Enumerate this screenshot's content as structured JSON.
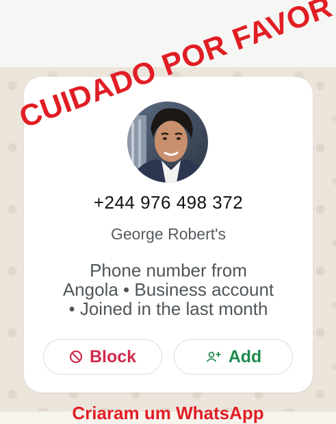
{
  "overlay": {
    "warning_text": "CUIDADO POR FAVOR",
    "bottom_caption": "Criaram um WhatsApp"
  },
  "contact_card": {
    "phone_number": "+244 976 498 372",
    "profile_name": "George Robert's",
    "info_lines": [
      "Phone number from",
      "Angola • Business account",
      "• Joined in the last month"
    ]
  },
  "actions": {
    "block_label": "Block",
    "add_label": "Add"
  },
  "colors": {
    "warning_red": "#e01e24",
    "block_red": "#d12a4c",
    "add_green": "#1d8a4f"
  },
  "icons": {
    "block": "block-icon",
    "add": "add-contact-icon"
  }
}
